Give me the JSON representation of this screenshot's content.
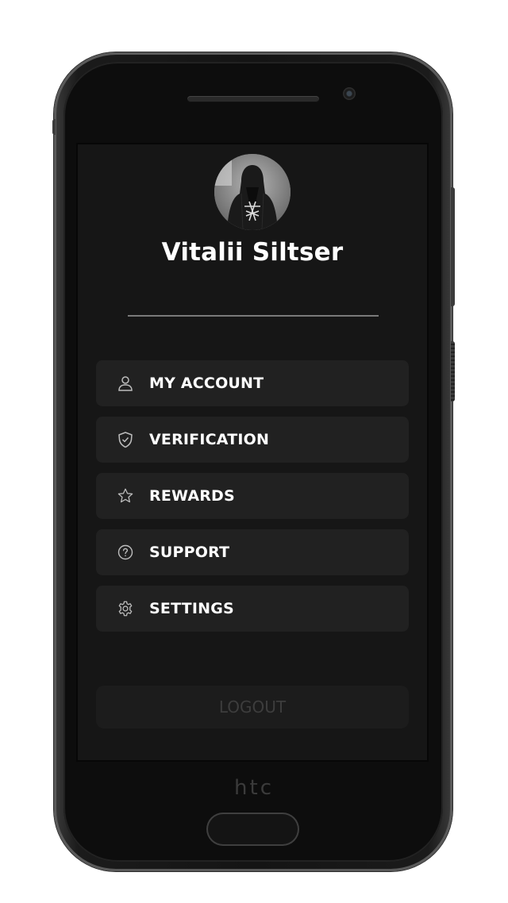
{
  "profile": {
    "name": "Vitalii Siltser"
  },
  "menu": {
    "items": [
      {
        "label": "MY ACCOUNT",
        "icon": "user-icon"
      },
      {
        "label": "VERIFICATION",
        "icon": "shield-check-icon"
      },
      {
        "label": "REWARDS",
        "icon": "star-icon"
      },
      {
        "label": "SUPPORT",
        "icon": "help-circle-icon"
      },
      {
        "label": "SETTINGS",
        "icon": "gear-icon"
      }
    ]
  },
  "logout": {
    "label": "LOGOUT"
  },
  "device": {
    "brand": "htc"
  },
  "colors": {
    "screen_bg": "#161616",
    "menu_item_bg": "#212121",
    "text": "#ffffff",
    "logout_text": "#3d3d3d"
  }
}
